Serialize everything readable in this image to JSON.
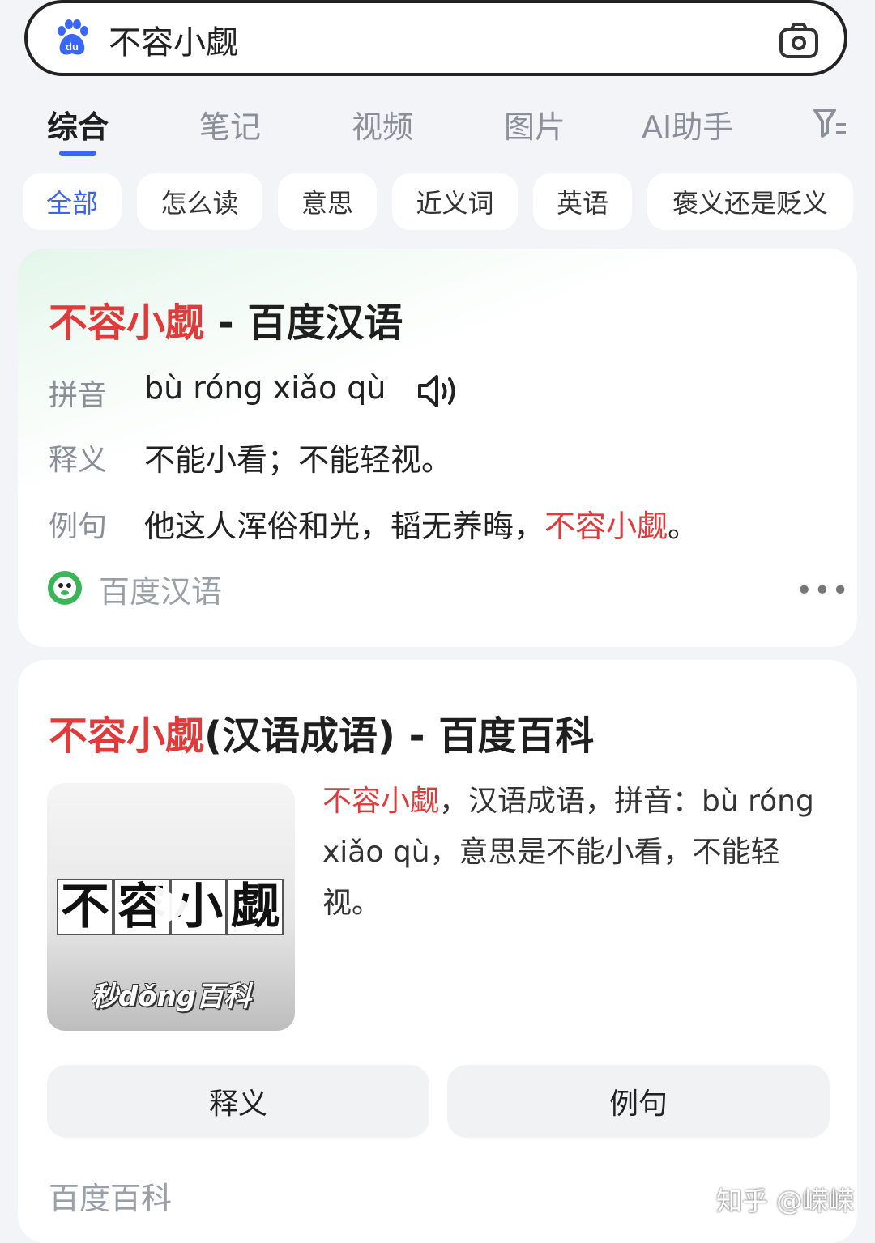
{
  "search": {
    "query": "不容小觑"
  },
  "tabs": [
    {
      "label": "综合",
      "active": true
    },
    {
      "label": "笔记"
    },
    {
      "label": "视频"
    },
    {
      "label": "图片"
    },
    {
      "label": "AI助手"
    }
  ],
  "chips": [
    "全部",
    "怎么读",
    "意思",
    "近义词",
    "英语",
    "褒义还是贬义"
  ],
  "card1": {
    "title_red": "不容小觑",
    "title_rest": " - 百度汉语",
    "pinyin_label": "拼音",
    "pinyin_value": "bù róng xiǎo qù",
    "meaning_label": "释义",
    "meaning_value": "不能小看；不能轻视。",
    "example_label": "例句",
    "example_prefix": "他这人浑俗和光，韬无养晦，",
    "example_red": "不容小觑",
    "example_suffix": "。",
    "source": "百度汉语"
  },
  "card2": {
    "title_red": "不容小觑",
    "title_rest": "(汉语成语) - 百度百科",
    "thumb_chars": [
      "不",
      "容",
      "小",
      "觑"
    ],
    "thumb_brand": "秒dǒng百科",
    "desc_red": "不容小觑",
    "desc_rest": "，汉语成语，拼音：bù róng xiǎo qù，意思是不能小看，不能轻视。",
    "btn_meaning": "释义",
    "btn_example": "例句",
    "source": "百度百科"
  },
  "watermark": "知乎 @嵘嵘",
  "colors": {
    "accent": "#3a66f4",
    "highlight": "#e03a3a"
  }
}
